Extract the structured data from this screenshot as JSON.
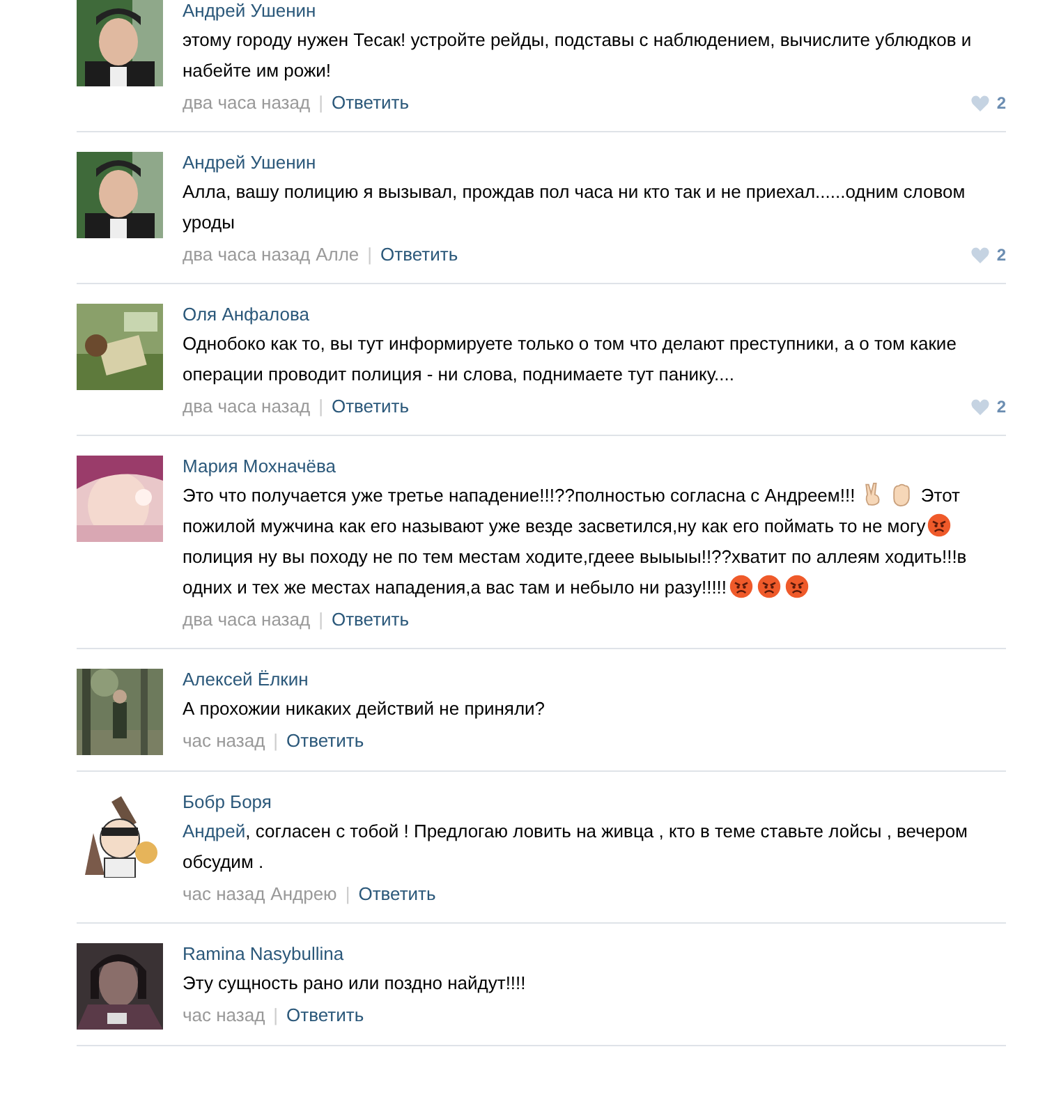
{
  "comments": [
    {
      "author": "Андрей Ушенин",
      "body": [
        {
          "kind": "text",
          "text": "этому городу нужен Тесак! устройте рейды, подставы с наблюдением, вычислите ублюдков и набейте им рожи!"
        }
      ],
      "time": "два часа назад",
      "separator": "|",
      "reply": "Ответить",
      "likes": "2"
    },
    {
      "author": "Андрей Ушенин",
      "body": [
        {
          "kind": "text",
          "text": "Алла, вашу полицию я вызывал, прождав пол часа ни кто так и не приехал......одним словом уроды"
        }
      ],
      "time": "два часа назад",
      "reply_to": "Алле",
      "separator": "|",
      "reply": "Ответить",
      "likes": "2"
    },
    {
      "author": "Оля Анфалова",
      "body": [
        {
          "kind": "text",
          "text": "Однобоко как то, вы тут информируете только о том что делают преступники, а о том какие операции проводит полиция - ни слова, поднимаете тут панику...."
        }
      ],
      "time": "два часа назад",
      "separator": "|",
      "reply": "Ответить",
      "likes": "2"
    },
    {
      "author": "Мария Мохначёва",
      "body": [
        {
          "kind": "text",
          "text": "Это что получается уже третье нападение!!!??полностью согласна с Андреем!!! "
        },
        {
          "kind": "victory"
        },
        {
          "kind": "fist"
        },
        {
          "kind": "text",
          "text": " Этот пожилой мужчина как его называют уже везде засветился,ну как его поймать то не могу"
        },
        {
          "kind": "angry"
        },
        {
          "kind": "text",
          "text": " полиция ну вы походу не по тем местам ходите,гдеее выыыы!!??хватит по аллеям ходить!!!в одних и тех же местах нападения,а вас там и небыло ни разу!!!!!"
        },
        {
          "kind": "angry"
        },
        {
          "kind": "angry"
        },
        {
          "kind": "angry"
        }
      ],
      "time": "два часа назад",
      "separator": "|",
      "reply": "Ответить"
    },
    {
      "author": "Алексей Ёлкин",
      "body": [
        {
          "kind": "text",
          "text": "А прохожии никаких действий не приняли?"
        }
      ],
      "time": "час назад",
      "separator": "|",
      "reply": "Ответить"
    },
    {
      "author": "Бобр Боря",
      "body": [
        {
          "kind": "link",
          "text": "Андрей"
        },
        {
          "kind": "text",
          "text": ", согласен с тобой ! Предлогаю ловить на живца , кто в теме ставьте лойсы , вечером обсудим ."
        }
      ],
      "time": "час назад",
      "reply_to": "Андрею",
      "separator": "|",
      "reply": "Ответить"
    },
    {
      "author": "Ramina Nasybullina",
      "body": [
        {
          "kind": "text",
          "text": "Эту сущность рано или поздно найдут!!!!"
        }
      ],
      "time": "час назад",
      "separator": "|",
      "reply": "Ответить"
    }
  ]
}
